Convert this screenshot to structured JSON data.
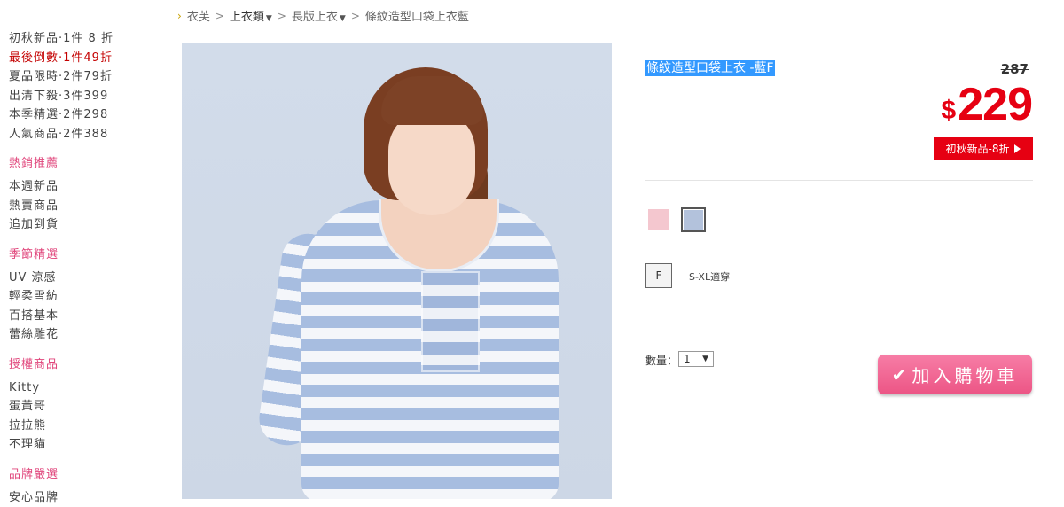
{
  "breadcrumb": {
    "home": "衣芙",
    "category": "上衣類",
    "subcategory": "長版上衣",
    "current": "條紋造型口袋上衣藍"
  },
  "sidebar": {
    "promos": [
      {
        "label": "初秋新品·1件 8 折",
        "highlight": false
      },
      {
        "label": "最後倒數·1件49折",
        "highlight": true
      },
      {
        "label": "夏品限時·2件79折",
        "highlight": false
      },
      {
        "label": "出清下殺·3件399",
        "highlight": false
      },
      {
        "label": "本季精選·2件298",
        "highlight": false
      },
      {
        "label": "人氣商品·2件388",
        "highlight": false
      }
    ],
    "hot_title": "熱銷推薦",
    "hot_items": [
      "本週新品",
      "熱賣商品",
      "追加到貨"
    ],
    "season_title": "季節精選",
    "season_items": [
      "UV 涼感",
      "輕柔雪紡",
      "百搭基本",
      "蕾絲雕花"
    ],
    "license_title": "授權商品",
    "license_items": [
      "Kitty",
      "蛋黃哥",
      "拉拉熊",
      "不理貓"
    ],
    "brand_title": "品牌嚴選",
    "brand_partial": "安心品牌"
  },
  "product": {
    "title": "條紋造型口袋上衣 -藍F",
    "original_price": "287",
    "currency": "$",
    "price": "229",
    "promo_badge": "初秋新品-8折",
    "colors": [
      {
        "name": "pink",
        "hex": "#f4c7cf",
        "selected": false
      },
      {
        "name": "blue",
        "hex": "#b3c2dc",
        "selected": true
      }
    ],
    "size": "F",
    "size_note": "S-XL適穿",
    "qty_label": "數量：",
    "qty_value": "1",
    "cart_button": "加入購物車"
  },
  "colors": {
    "accent_red": "#e60012",
    "section_pink": "#e0457b",
    "cart_pink": "#f0628f",
    "selection_blue": "#3399ff"
  }
}
